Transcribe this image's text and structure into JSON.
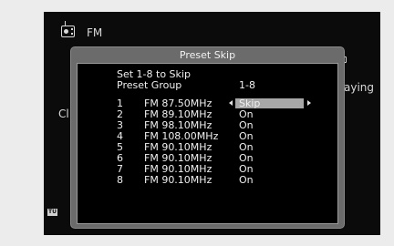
{
  "background": {
    "source_label": "FM",
    "left_partial_text": "Cl",
    "right_partial_text": "aying",
    "badge": "TU"
  },
  "dialog": {
    "title": "Preset Skip",
    "line1": "Set 1-8 to Skip",
    "preset_group_label": "Preset Group",
    "preset_group_value": "1-8",
    "presets": [
      {
        "num": "1",
        "freq": "FM 87.50MHz",
        "value": "Skip"
      },
      {
        "num": "2",
        "freq": "FM 89.10MHz",
        "value": "On"
      },
      {
        "num": "3",
        "freq": "FM 98.10MHz",
        "value": "On"
      },
      {
        "num": "4",
        "freq": "FM 108.00MHz",
        "value": "On"
      },
      {
        "num": "5",
        "freq": "FM 90.10MHz",
        "value": "On"
      },
      {
        "num": "6",
        "freq": "FM 90.10MHz",
        "value": "On"
      },
      {
        "num": "7",
        "freq": "FM 90.10MHz",
        "value": "On"
      },
      {
        "num": "8",
        "freq": "FM 90.10MHz",
        "value": "On"
      }
    ]
  },
  "colors": {
    "screen_bg": "#0b0b0b",
    "dialog_frame": "#6b6b6b",
    "selection": "#a7a7a7",
    "text": "#f0f0f0"
  }
}
